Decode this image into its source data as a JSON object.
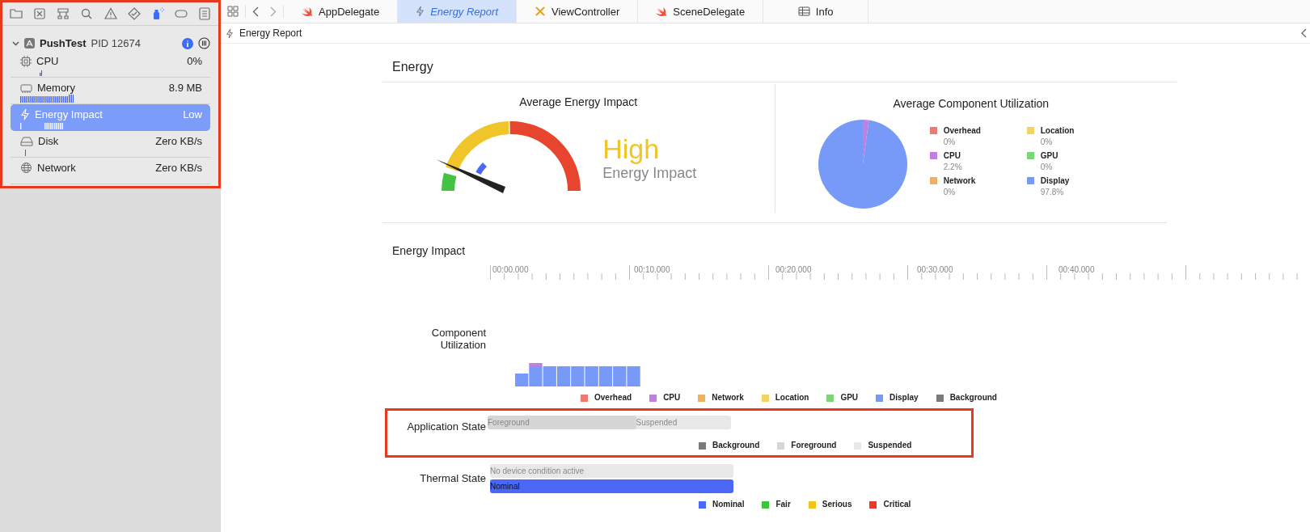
{
  "navigator_tabs": [
    {
      "kind": "folder",
      "selected": false
    },
    {
      "kind": "xsquare",
      "selected": false
    },
    {
      "kind": "hierarchy",
      "selected": false
    },
    {
      "kind": "search",
      "selected": false
    },
    {
      "kind": "warning",
      "selected": false
    },
    {
      "kind": "diamond",
      "selected": false
    },
    {
      "kind": "spray",
      "selected": true
    },
    {
      "kind": "label",
      "selected": false
    },
    {
      "kind": "list",
      "selected": false
    }
  ],
  "process": {
    "name": "PushTest",
    "pid": "PID 12674",
    "expanded": true
  },
  "gauges": [
    {
      "kind": "cpu",
      "label": "CPU",
      "value": "0%",
      "selected": false
    },
    {
      "kind": "memory",
      "label": "Memory",
      "value": "8.9 MB",
      "selected": false
    },
    {
      "kind": "energy",
      "label": "Energy Impact",
      "value": "Low",
      "selected": true
    },
    {
      "kind": "disk",
      "label": "Disk",
      "value": "Zero KB/s",
      "selected": false
    },
    {
      "kind": "network",
      "label": "Network",
      "value": "Zero KB/s",
      "selected": false
    }
  ],
  "tabs": [
    {
      "kind": "swift",
      "label": "AppDelegate",
      "selected": false
    },
    {
      "kind": "energy",
      "label": "Energy Report",
      "selected": true
    },
    {
      "kind": "tools",
      "label": "ViewController",
      "selected": false
    },
    {
      "kind": "swift",
      "label": "SceneDelegate",
      "selected": false
    },
    {
      "kind": "table",
      "label": "Info",
      "selected": false
    }
  ],
  "breadcrumb": "Energy Report",
  "report": {
    "title": "Energy",
    "average_energy_impact": {
      "title": "Average Energy Impact",
      "rating": "High",
      "caption": "Energy Impact"
    },
    "average_component_utilization": {
      "title": "Average Component Utilization",
      "chart_data": {
        "type": "pie",
        "categories": [
          "Overhead",
          "CPU",
          "Network",
          "Location",
          "GPU",
          "Display"
        ],
        "values": [
          0,
          2.2,
          0,
          0,
          0,
          97.8
        ]
      },
      "legend": [
        {
          "value": "0%",
          "color": "#ec7b6f"
        },
        {
          "value": "2.2%",
          "color": "#bf80e0"
        },
        {
          "value": "0%",
          "color": "#efb062"
        },
        {
          "value": "0%",
          "color": "#f2d462"
        },
        {
          "value": "0%",
          "color": "#7dd47a"
        },
        {
          "value": "97.8%",
          "color": "#7799f7"
        }
      ]
    },
    "energy_impact": {
      "title": "Energy Impact",
      "time_labels": [
        "00:00.000",
        "00:10.000",
        "00:20.000",
        "00:30.000",
        "00:40.000"
      ],
      "component_utilization_label": "Component Utilization",
      "component_legend": [
        {
          "label": "Overhead",
          "color": "#ec7b6f"
        },
        {
          "label": "CPU",
          "color": "#bf80e0"
        },
        {
          "label": "Network",
          "color": "#efb062"
        },
        {
          "label": "Location",
          "color": "#f2d462"
        },
        {
          "label": "GPU",
          "color": "#7dd47a"
        },
        {
          "label": "Display",
          "color": "#7799f7"
        },
        {
          "label": "Background",
          "color": "#7a7a7a"
        }
      ],
      "application_state": {
        "label": "Application State",
        "foreground": {
          "label": "Foreground",
          "level": 0.61
        },
        "suspended_label": "Suspended",
        "legend": [
          {
            "label": "Background",
            "color": "#7a7a7a"
          },
          {
            "label": "Foreground",
            "color": "#d6d6d6"
          },
          {
            "label": "Suspended",
            "color": "#e8e8e8"
          }
        ]
      },
      "thermal_state": {
        "label": "Thermal State",
        "condition": "No device condition active",
        "state": "Nominal",
        "legend": [
          {
            "label": "Nominal",
            "color": "#4a67f5"
          },
          {
            "label": "Fair",
            "color": "#3cc43c"
          },
          {
            "label": "Serious",
            "color": "#f3c21c"
          },
          {
            "label": "Critical",
            "color": "#e8392b"
          }
        ]
      }
    }
  }
}
